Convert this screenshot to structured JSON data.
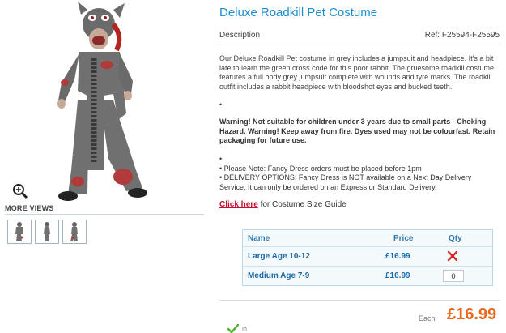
{
  "product": {
    "title": "Deluxe Roadkill Pet Costume",
    "description_tab": "Description",
    "ref": "Ref: F25594-F25595",
    "description": "Our Deluxe Roadkill Pet costume in grey includes a jumpsuit and headpiece. It's a bit late to learn the green cross code for this poor rabbit. The gruesome roadkill costume features a full body grey jumpsuit complete with wounds and tyre marks. The roadkill outfit includes a rabbit headpiece with bloodshot eyes and bucked teeth.",
    "bullet": "•",
    "warning": "Warning! Not suitable for children under 3 years due to small parts - Choking Hazard. Warning! Keep away from fire. Dyes used may not be colourfast. Retain packaging for future use.",
    "notes": [
      "•",
      "• Please Note: Fancy Dress orders must be placed before 1pm",
      "• DELIVERY OPTIONS: Fancy Dress is NOT available on a Next Day Delivery Service, It can only be ordered on an Express or Standard Delivery."
    ],
    "size_guide_link": "Click here",
    "size_guide_text": " for Costume Size Guide"
  },
  "gallery": {
    "more_views_label": "MORE VIEWS",
    "zoom_icon": "magnifier-plus-icon",
    "thumb_count": 3
  },
  "size_table": {
    "headers": {
      "name": "Name",
      "price": "Price",
      "qty": "Qty"
    },
    "rows": [
      {
        "name": "Large Age 10-12",
        "price": "£16.99",
        "qty_status": "unavailable",
        "qty_icon": "red-x-icon"
      },
      {
        "name": "Medium Age 7-9",
        "price": "£16.99",
        "qty_value": "0"
      }
    ]
  },
  "pricing": {
    "each_label": "Each",
    "price": "£16.99",
    "stock_icon": "green-check-icon",
    "stock_text": "In"
  },
  "colors": {
    "title_blue": "#1a8ccf",
    "price_orange": "#e8671a",
    "link_red": "#c8102e",
    "table_blue": "#1d6aa5"
  }
}
